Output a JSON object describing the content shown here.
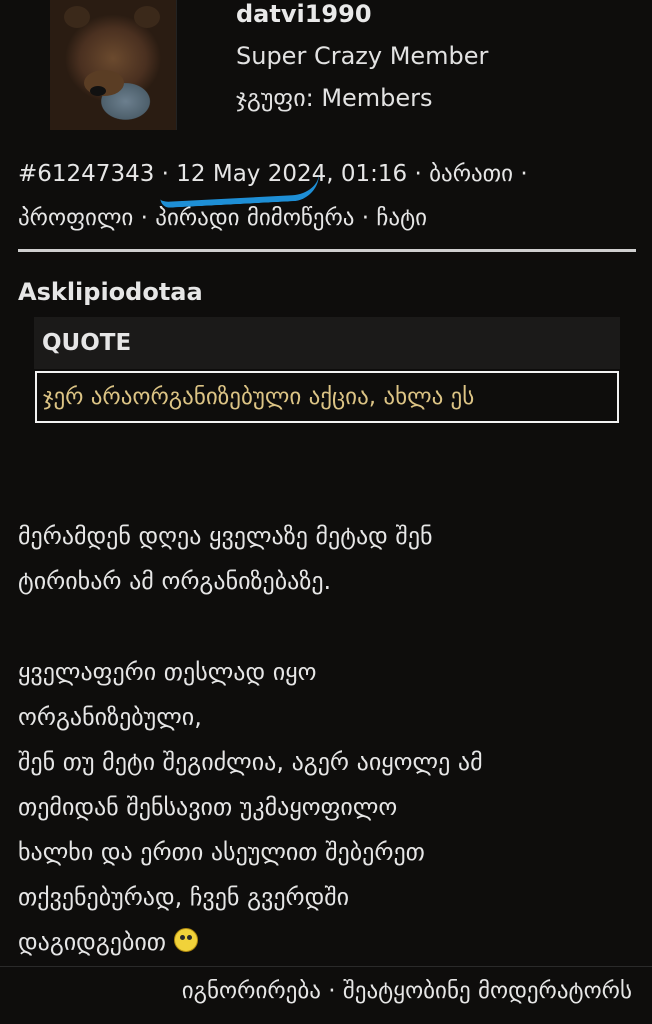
{
  "post": {
    "author": {
      "username": "datvi1990",
      "rank": "Super Crazy Member",
      "group": "ჯგუფი: Members"
    },
    "id": "#61247343",
    "date": "12 May 2024, 01:16",
    "sep": "·",
    "links": {
      "card": "ბარათი",
      "profile": "პროფილი",
      "pm": "პირადი მიმოწერა",
      "chat": "ჩატი"
    },
    "quote": {
      "author": "Asklipiodotaa",
      "header": "QUOTE",
      "text": "ჯერ არაორგანიზებული აქცია, ახლა ეს"
    },
    "message": {
      "para1_l1": "მერამდენ დღეა ყველაზე მეტად შენ",
      "para1_l2": "ტირიხარ ამ ორგანიზებაზე.",
      "para2_l1": "ყველაფერი თესლად იყო",
      "para2_l2": "ორგანიზებული,",
      "para2_l3": "შენ თუ მეტი შეგიძლია, აგერ აიყოლე ამ",
      "para2_l4": "თემიდან შენსავით უკმაყოფილო",
      "para2_l5": "ხალხი და ერთი ასეულით შებერეთ",
      "para2_l6": "თქვენებურად, ჩვენ გვერდში",
      "para2_l7": "დაგიდგებით",
      "emoji": "confused-smiley-icon"
    },
    "footer": {
      "ignore": "იგნორირება",
      "report": "შეატყობინე მოდერატორს"
    }
  },
  "colors": {
    "background": "#0e0d0c",
    "quote_text": "#dcc485",
    "annotation_underline": "#1e8fd6"
  }
}
